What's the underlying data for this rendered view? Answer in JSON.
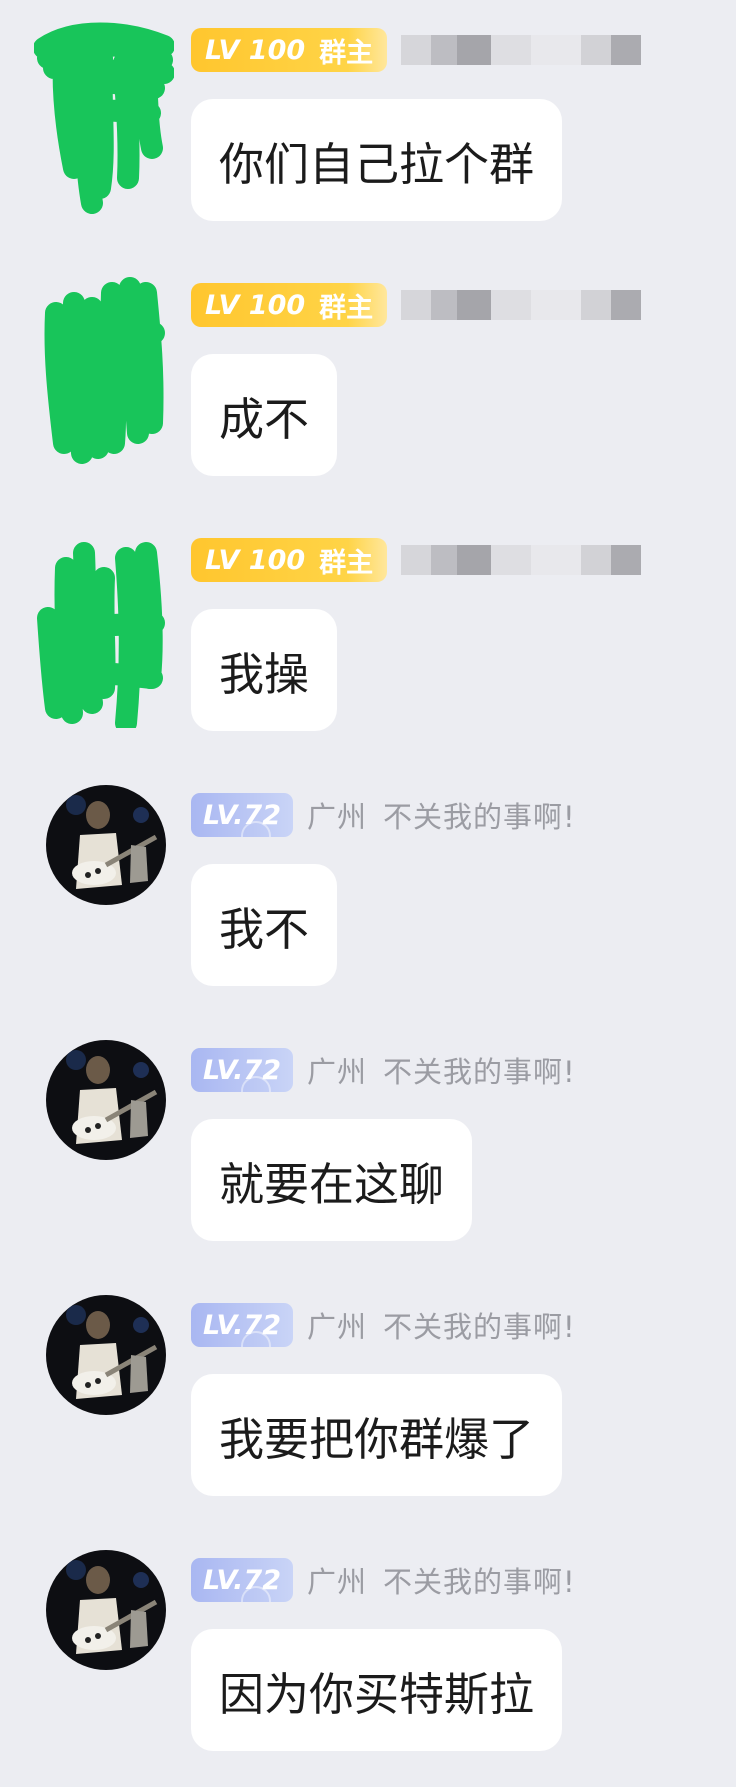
{
  "colors": {
    "background": "#ECEDF2",
    "bubble": "#FFFFFF",
    "owner_badge": "#FFC62E",
    "level_badge": "#A9B7F2",
    "scribble_green": "#18C55A",
    "meta_text": "#9B9CA3"
  },
  "owner_badge": {
    "level": "LV 100",
    "role": "群主"
  },
  "member": {
    "level": "LV.72",
    "city": "广州",
    "name": "不关我的事啊!"
  },
  "messages": [
    {
      "sender": "owner",
      "avatar_icon": "scribbled-out-avatar-icon",
      "text": "你们自己拉个群"
    },
    {
      "sender": "owner",
      "avatar_icon": "scribbled-out-avatar-icon",
      "text": "成不"
    },
    {
      "sender": "owner",
      "avatar_icon": "scribbled-out-avatar-icon",
      "text": "我操"
    },
    {
      "sender": "member",
      "avatar_icon": "guitarist-photo-avatar",
      "text": "我不"
    },
    {
      "sender": "member",
      "avatar_icon": "guitarist-photo-avatar",
      "text": "就要在这聊"
    },
    {
      "sender": "member",
      "avatar_icon": "guitarist-photo-avatar",
      "text": "我要把你群爆了"
    },
    {
      "sender": "member",
      "avatar_icon": "guitarist-photo-avatar",
      "text": "因为你买特斯拉"
    }
  ]
}
